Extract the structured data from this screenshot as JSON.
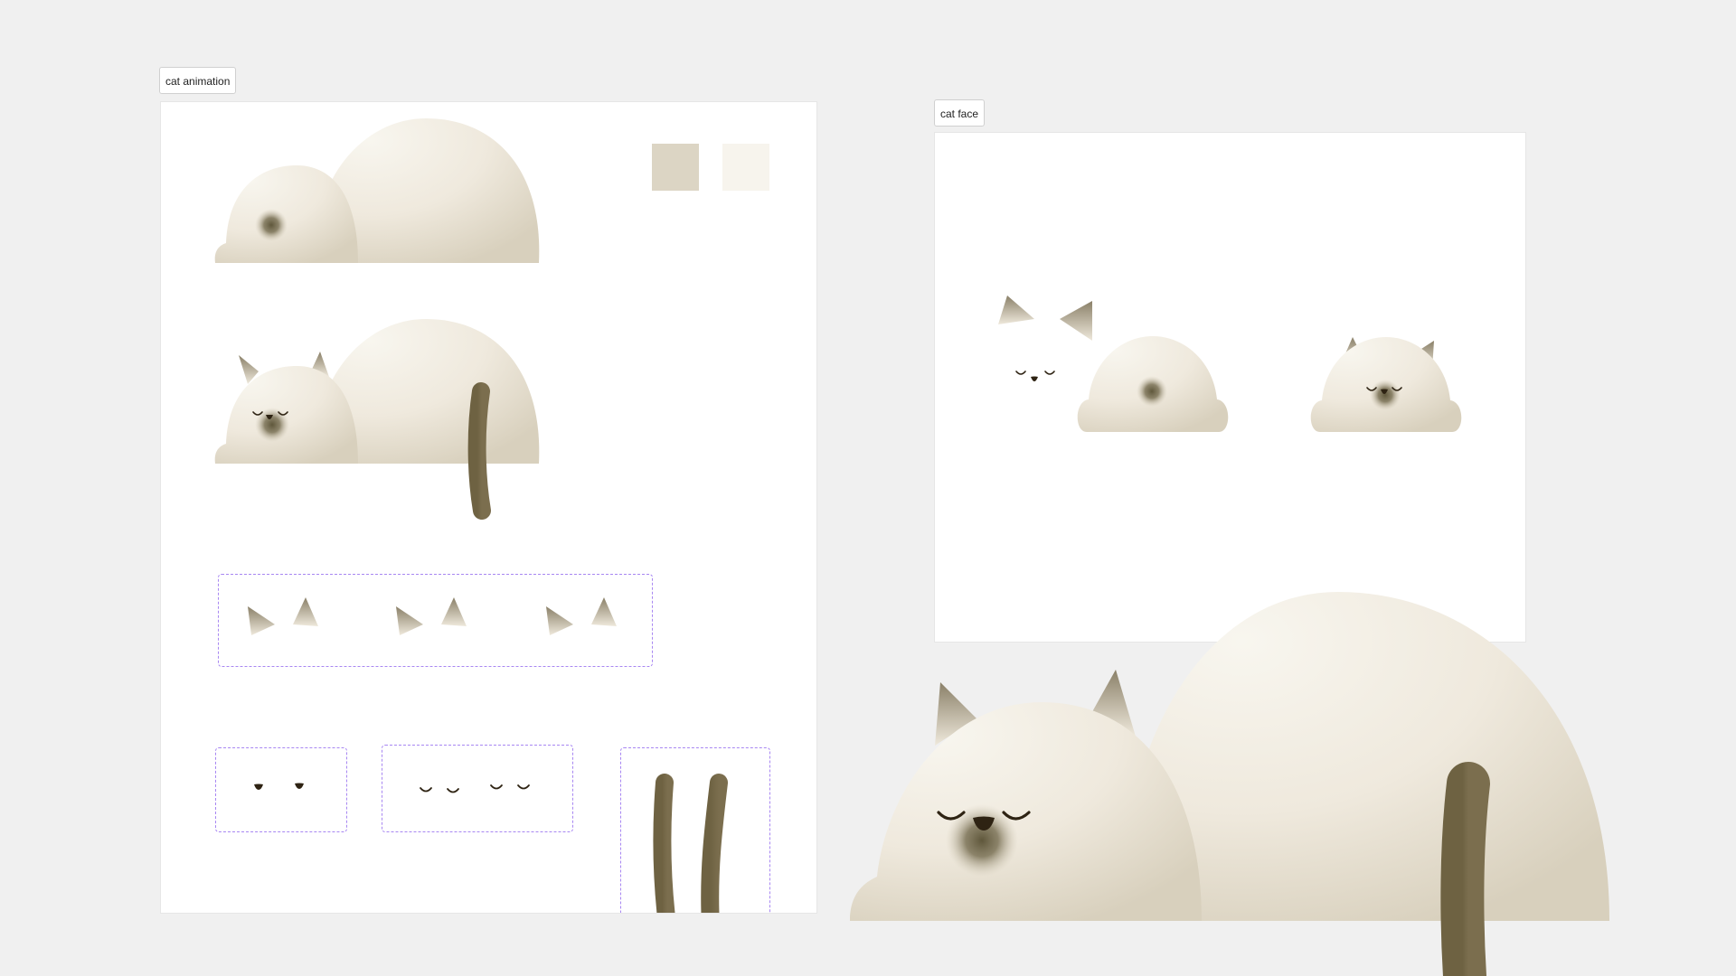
{
  "canvas": {
    "background": "#f0f0f0",
    "frames": [
      {
        "label": "cat animation"
      },
      {
        "label": "cat face"
      }
    ]
  },
  "palette": {
    "fur_light": "#f7f4ed",
    "fur_shade": "#dcd5c4",
    "tail": "#736647",
    "nose_smudge": "#6d6446",
    "ear_tip": "#8f8570",
    "feature_dark": "#2e2313",
    "selection_outline": "#a887f2",
    "swatches": [
      "#dcd5c4",
      "#f7f4ed"
    ]
  }
}
